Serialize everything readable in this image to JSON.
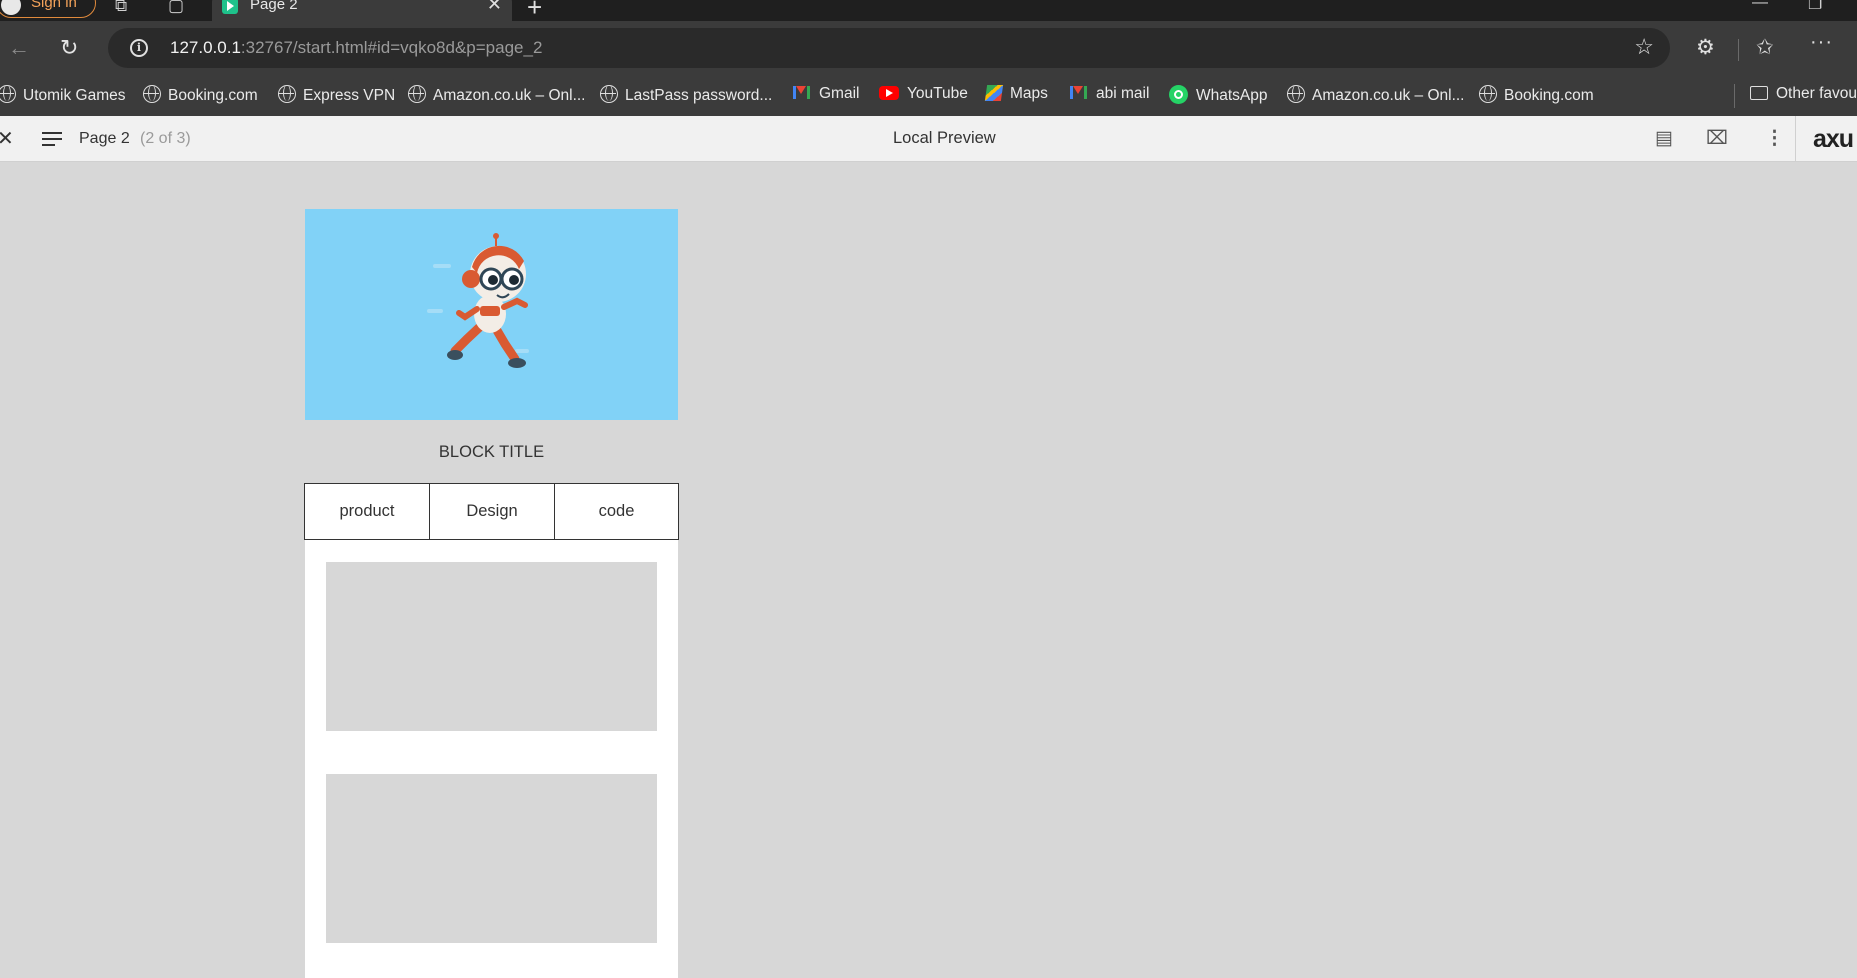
{
  "browser": {
    "signin_label": "Sign in",
    "tab_title": "Page 2",
    "url_host": "127.0.0.1",
    "url_rest": ":32767/start.html#id=vqko8d&p=page_2",
    "more_label": "···"
  },
  "bookmarks": [
    {
      "label": "Utomik Games",
      "icon": "globe"
    },
    {
      "label": "Booking.com",
      "icon": "globe"
    },
    {
      "label": "Express VPN",
      "icon": "globe"
    },
    {
      "label": "Amazon.co.uk – Onl...",
      "icon": "globe"
    },
    {
      "label": "LastPass password...",
      "icon": "globe"
    },
    {
      "label": "Gmail",
      "icon": "gmail"
    },
    {
      "label": "YouTube",
      "icon": "youtube"
    },
    {
      "label": "Maps",
      "icon": "maps"
    },
    {
      "label": "abi mail",
      "icon": "gmail"
    },
    {
      "label": "WhatsApp",
      "icon": "whatsapp"
    },
    {
      "label": "Amazon.co.uk – Onl...",
      "icon": "globe"
    },
    {
      "label": "Booking.com",
      "icon": "globe"
    },
    {
      "label": "Other favou",
      "icon": "folder"
    }
  ],
  "preview": {
    "page_name": "Page 2",
    "page_count": "(2 of 3)",
    "title": "Local Preview",
    "logo": "axu"
  },
  "content": {
    "block_title": "BLOCK TITLE",
    "tabs": [
      "product",
      "Design",
      "code"
    ],
    "hero_bg": "#81d2f7"
  }
}
